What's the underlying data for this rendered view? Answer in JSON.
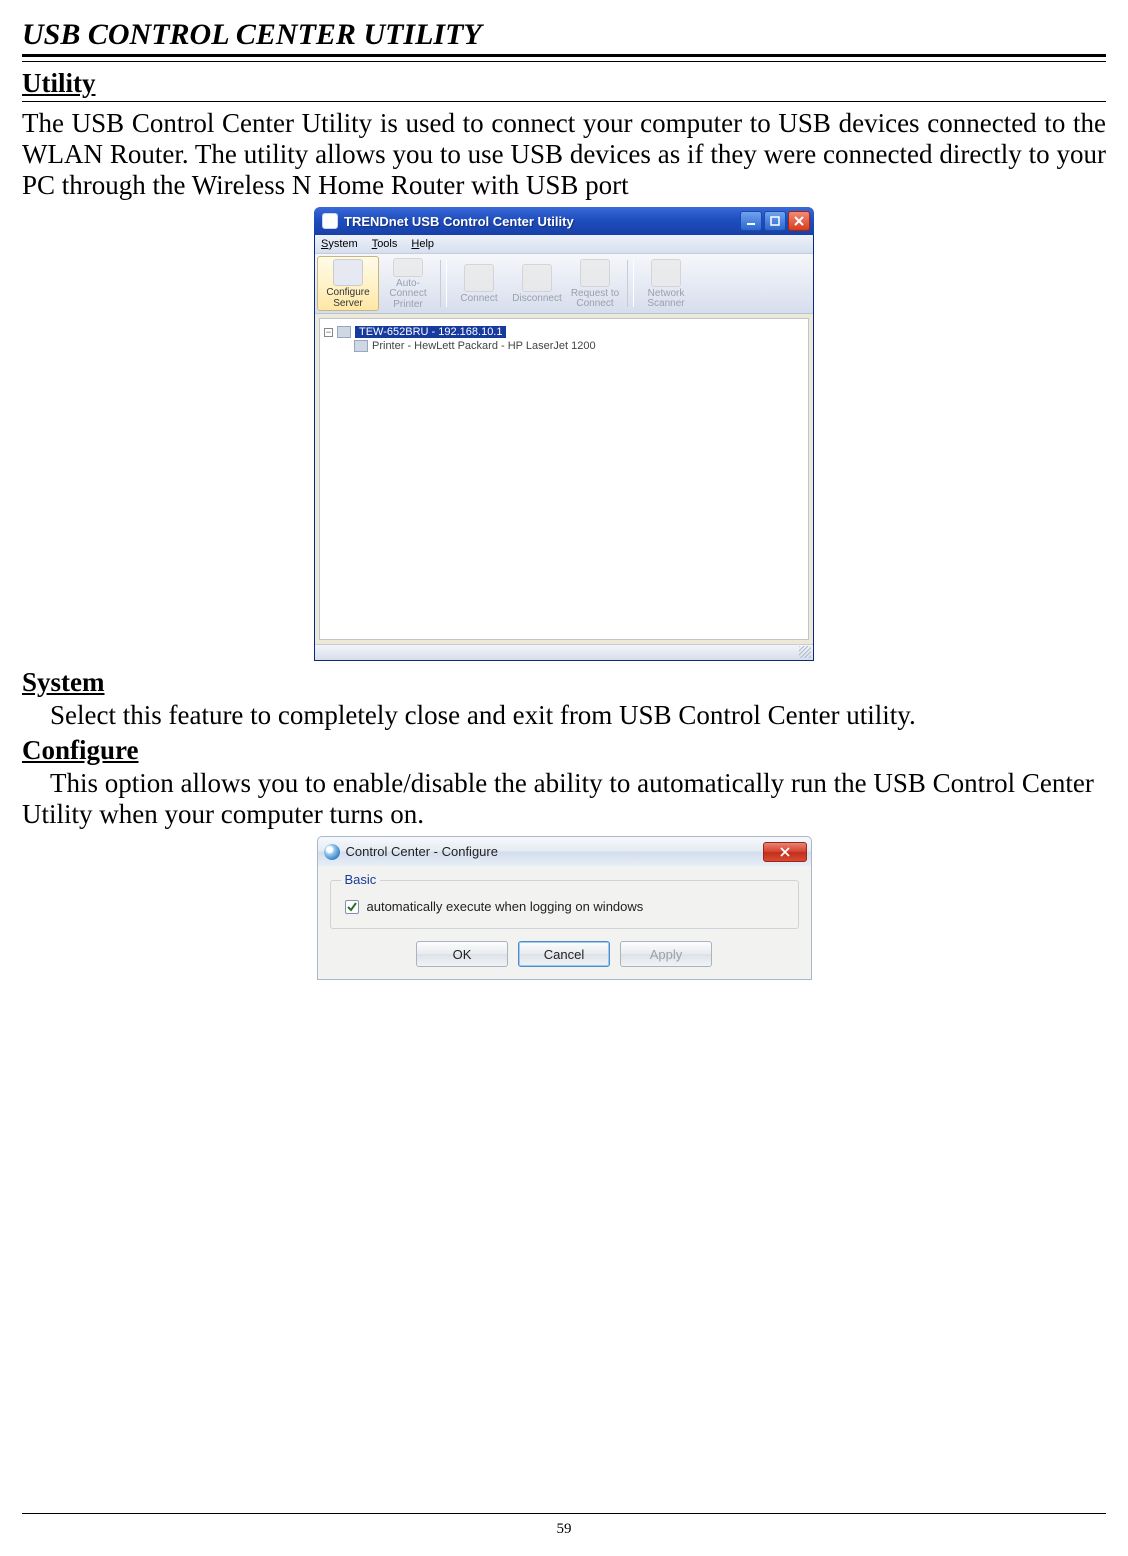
{
  "doc": {
    "page_title": "USB CONTROL CENTER UTILITY",
    "page_number": "59"
  },
  "sections": {
    "utility": {
      "heading": "Utility",
      "paragraph": "The USB Control Center Utility is used to connect your computer to USB devices connected to the WLAN Router. The utility allows you to use USB devices as if they were connected directly to your PC through the Wireless N Home Router with USB port"
    },
    "system": {
      "heading": "System",
      "paragraph": "Select this feature to completely close and exit from USB Control Center utility."
    },
    "configure": {
      "heading": "Configure",
      "paragraph": "This option allows you to enable/disable the ability to automatically run the USB Control Center Utility when your computer turns on."
    }
  },
  "fig1": {
    "window_title": "TRENDnet USB Control Center Utility",
    "menu": {
      "system": "System",
      "tools": "Tools",
      "help": "Help"
    },
    "toolbar": {
      "configure_server": "Configure\nServer",
      "auto_connect_printer": "Auto-Connect\nPrinter",
      "connect": "Connect",
      "disconnect": "Disconnect",
      "request_to_connect": "Request to\nConnect",
      "network_scanner": "Network\nScanner"
    },
    "tree": {
      "root": "TEW-652BRU - 192.168.10.1",
      "child": "Printer - HewLett Packard - HP LaserJet 1200"
    }
  },
  "fig2": {
    "window_title": "Control Center - Configure",
    "group_label": "Basic",
    "checkbox_label": "automatically execute when logging on windows",
    "buttons": {
      "ok": "OK",
      "cancel": "Cancel",
      "apply": "Apply"
    }
  }
}
